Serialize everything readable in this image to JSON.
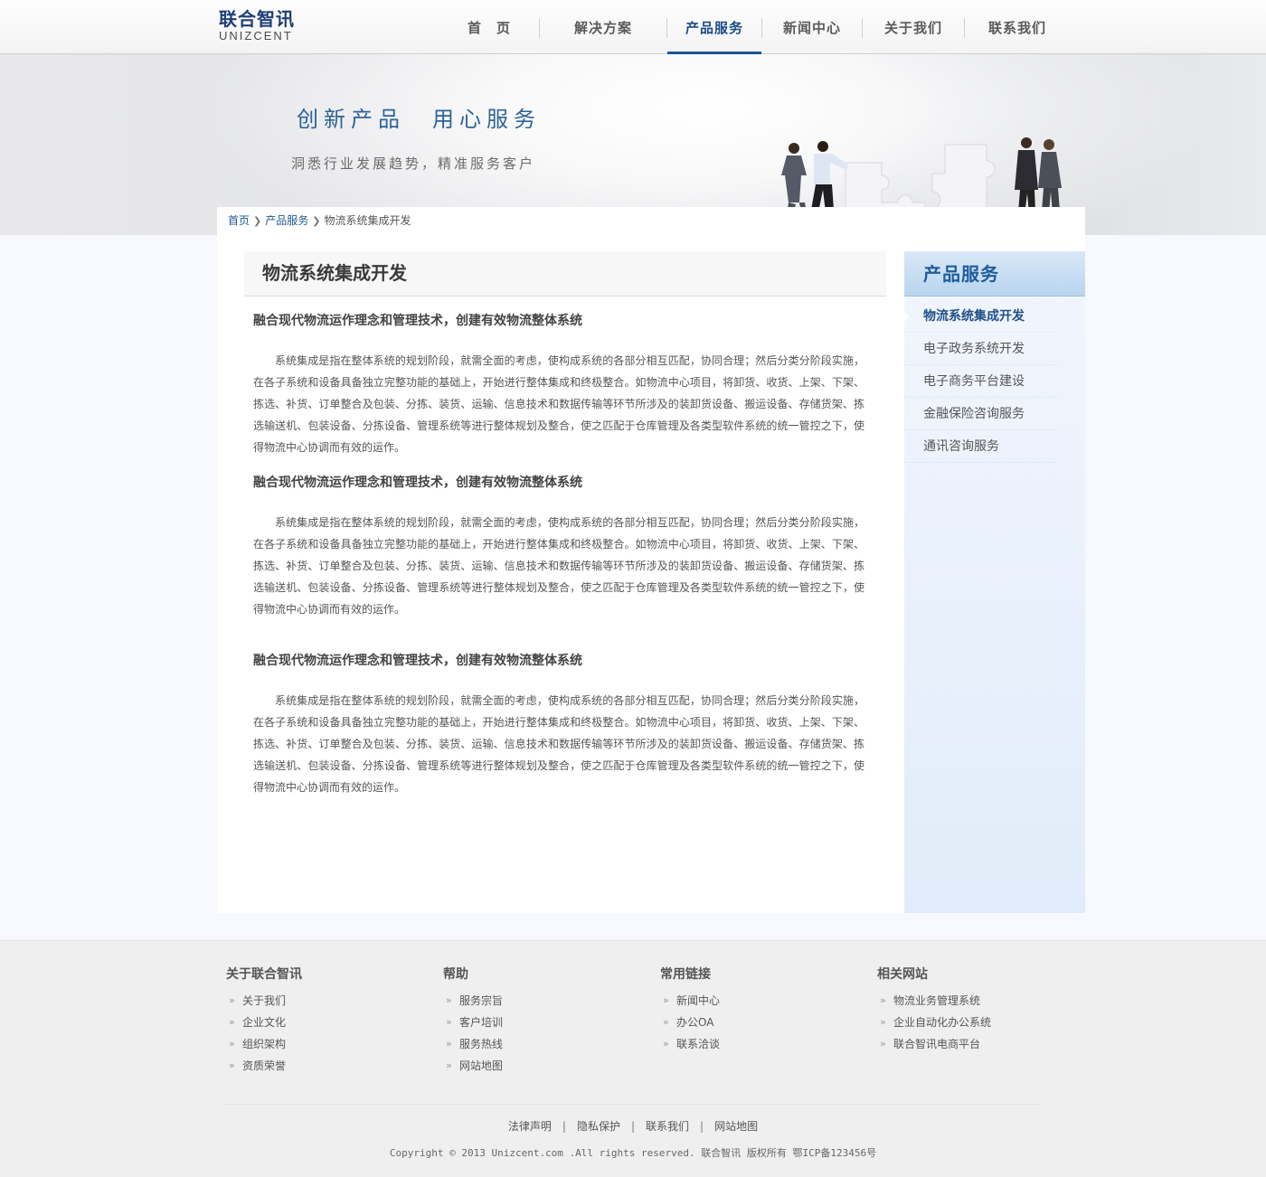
{
  "logo": {
    "cn": "联合智讯",
    "en": "UNIZCENT"
  },
  "nav": {
    "items": [
      {
        "label": "首　页"
      },
      {
        "label": "解决方案"
      },
      {
        "label": "产品服务"
      },
      {
        "label": "新闻中心"
      },
      {
        "label": "关于我们"
      },
      {
        "label": "联系我们"
      }
    ],
    "active_index": 2
  },
  "banner": {
    "title": "创新产品　用心服务",
    "subtitle": "洞悉行业发展趋势，精准服务客户"
  },
  "breadcrumb": {
    "home": "首页",
    "category": "产品服务",
    "current": "物流系统集成开发"
  },
  "content": {
    "title": "物流系统集成开发",
    "sections": [
      {
        "heading": "融合现代物流运作理念和管理技术，创建有效物流整体系统",
        "body": "系统集成是指在整体系统的规划阶段，就需全面的考虑，使构成系统的各部分相互匹配，协同合理；然后分类分阶段实施，在各子系统和设备具备独立完整功能的基础上，开始进行整体集成和终极整合。如物流中心项目，将卸货、收货、上架、下架、拣选、补货、订单整合及包装、分拣、装货、运输、信息技术和数据传输等环节所涉及的装卸货设备、搬运设备、存储货架、拣选输送机、包装设备、分拣设备、管理系统等进行整体规划及整合，使之匹配于仓库管理及各类型软件系统的统一管控之下，使得物流中心协调而有效的运作。"
      },
      {
        "heading": "融合现代物流运作理念和管理技术，创建有效物流整体系统",
        "body": "系统集成是指在整体系统的规划阶段，就需全面的考虑，使构成系统的各部分相互匹配，协同合理；然后分类分阶段实施，在各子系统和设备具备独立完整功能的基础上，开始进行整体集成和终极整合。如物流中心项目，将卸货、收货、上架、下架、拣选、补货、订单整合及包装、分拣、装货、运输、信息技术和数据传输等环节所涉及的装卸货设备、搬运设备、存储货架、拣选输送机、包装设备、分拣设备、管理系统等进行整体规划及整合，使之匹配于仓库管理及各类型软件系统的统一管控之下，使得物流中心协调而有效的运作。"
      },
      {
        "heading": "融合现代物流运作理念和管理技术，创建有效物流整体系统",
        "body": "系统集成是指在整体系统的规划阶段，就需全面的考虑，使构成系统的各部分相互匹配，协同合理；然后分类分阶段实施，在各子系统和设备具备独立完整功能的基础上，开始进行整体集成和终极整合。如物流中心项目，将卸货、收货、上架、下架、拣选、补货、订单整合及包装、分拣、装货、运输、信息技术和数据传输等环节所涉及的装卸货设备、搬运设备、存储货架、拣选输送机、包装设备、分拣设备、管理系统等进行整体规划及整合，使之匹配于仓库管理及各类型软件系统的统一管控之下，使得物流中心协调而有效的运作。"
      }
    ]
  },
  "sidebar": {
    "title": "产品服务",
    "items": [
      {
        "label": "物流系统集成开发"
      },
      {
        "label": "电子政务系统开发"
      },
      {
        "label": "电子商务平台建设"
      },
      {
        "label": "金融保险咨询服务"
      },
      {
        "label": "通讯咨询服务"
      }
    ]
  },
  "footer": {
    "columns": [
      {
        "title": "关于联合智讯",
        "links": [
          "关于我们",
          "企业文化",
          "组织架构",
          "资质荣誉"
        ]
      },
      {
        "title": "帮助",
        "links": [
          "服务宗旨",
          "客户培训",
          "服务热线",
          "网站地图"
        ]
      },
      {
        "title": "常用链接",
        "links": [
          "新闻中心",
          "办公OA",
          "联系洽谈"
        ]
      },
      {
        "title": "相关网站",
        "links": [
          "物流业务管理系统",
          "企业自动化办公系统",
          "联合智讯电商平台"
        ]
      }
    ],
    "bottom_links": [
      "法律声明",
      "隐私保护",
      "联系我们",
      "网站地图"
    ],
    "separator": "|",
    "copyright": "Copyright © 2013  Unizcent.com .All rights reserved. 联合智讯 版权所有  鄂ICP备123456号"
  },
  "colors": {
    "brand": "#1d3e77",
    "nav_active": "#1b5598",
    "link": "#1f5a8f",
    "sidebar_title": "#1e5d9b"
  }
}
